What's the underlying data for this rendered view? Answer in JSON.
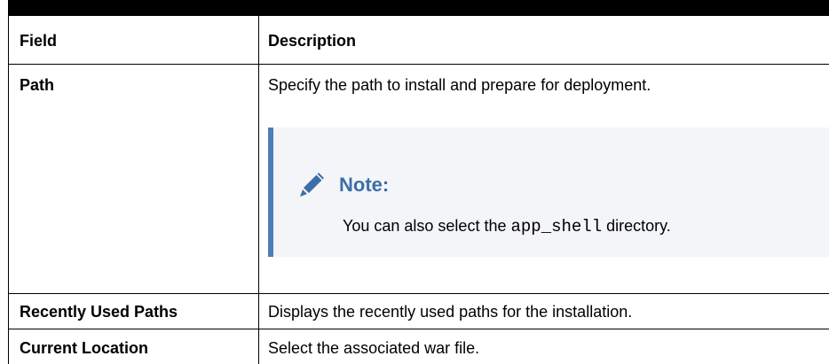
{
  "table": {
    "headers": {
      "field": "Field",
      "description": "Description"
    },
    "rows": [
      {
        "field": "Path",
        "description": "Specify the path to install and prepare for deployment.",
        "note": {
          "title": "Note:",
          "text_before": "You can also select the",
          "code": "app_shell",
          "text_after": "directory."
        }
      },
      {
        "field": "Recently Used Paths",
        "description": "Displays the recently used paths for the installation."
      },
      {
        "field": "Current Location",
        "description": "Select the associated war file."
      }
    ]
  },
  "colors": {
    "note_accent": "#4f7db7",
    "note_title": "#3e6ea8",
    "note_background": "#f4f5f8"
  }
}
